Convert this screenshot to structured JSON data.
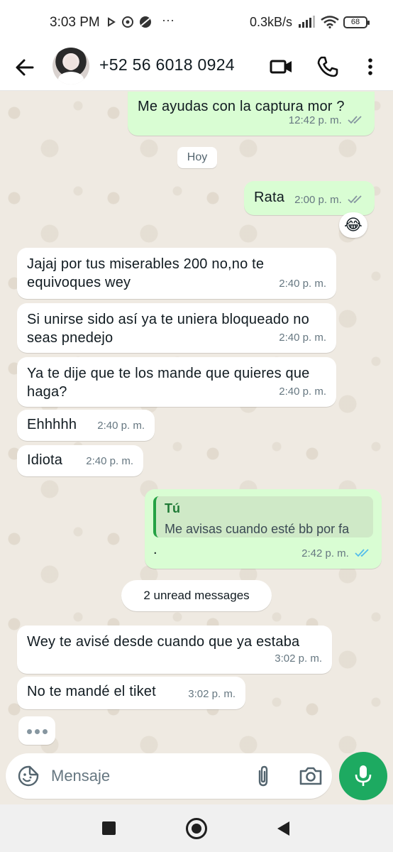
{
  "status_bar": {
    "time": "3:03 PM",
    "more": "···",
    "network_speed": "0.3kB/s",
    "battery": "68",
    "icons": [
      "play-icon",
      "messenger-icon",
      "vpn-icon",
      "signal-icon",
      "wifi-icon",
      "battery-icon"
    ]
  },
  "header": {
    "contact_name": "+52 56 6018 0924",
    "icons": [
      "back-arrow-icon",
      "video-call-icon",
      "voice-call-icon",
      "more-vert-icon"
    ]
  },
  "chat": {
    "day_label": "Hoy",
    "reaction_emoji": "😂",
    "quoted_reply": {
      "author": "Tú",
      "text": "Me avisas cuando esté bb por fa"
    },
    "unread_label": "2 unread messages",
    "messages": [
      {
        "direction": "out",
        "text": "Me ayudas con la captura mor ?",
        "time": "12:42 p. m.",
        "status": "read-grey"
      },
      {
        "direction": "out",
        "text": "Rata",
        "time": "2:00 p. m.",
        "status": "read-grey"
      },
      {
        "direction": "in",
        "text": "Jajaj por tus miserables 200  no,no te equivoques wey",
        "time": "2:40 p. m."
      },
      {
        "direction": "in",
        "text": "Si unirse sido así ya te uniera bloqueado no seas pnedejo",
        "time": "2:40 p. m."
      },
      {
        "direction": "in",
        "text": "Ya te dije que te los mande que quieres que haga?",
        "time": "2:40 p. m."
      },
      {
        "direction": "in",
        "text": "Ehhhhh",
        "time": "2:40 p. m."
      },
      {
        "direction": "in",
        "text": "Idiota",
        "time": "2:40 p. m."
      },
      {
        "direction": "out",
        "text": ".",
        "time": "2:42 p. m.",
        "status": "read-blue"
      },
      {
        "direction": "in",
        "text": "Wey te avisé desde cuando que ya estaba",
        "time": "3:02 p. m."
      },
      {
        "direction": "in",
        "text": "No te mandé el tiket",
        "time": "3:02 p. m."
      }
    ],
    "typing_indicator": "•••"
  },
  "input_bar": {
    "placeholder": "Mensaje",
    "value": "",
    "icons": [
      "emoji-sticker-icon",
      "attach-icon",
      "camera-icon",
      "mic-icon"
    ]
  },
  "colors": {
    "chat_background": "#efeae2",
    "outgoing_bubble": "#d9fdd3",
    "incoming_bubble": "#ffffff",
    "accent_green": "#1daa61",
    "read_tick_blue": "#53bdeb",
    "meta_grey": "#667781"
  }
}
